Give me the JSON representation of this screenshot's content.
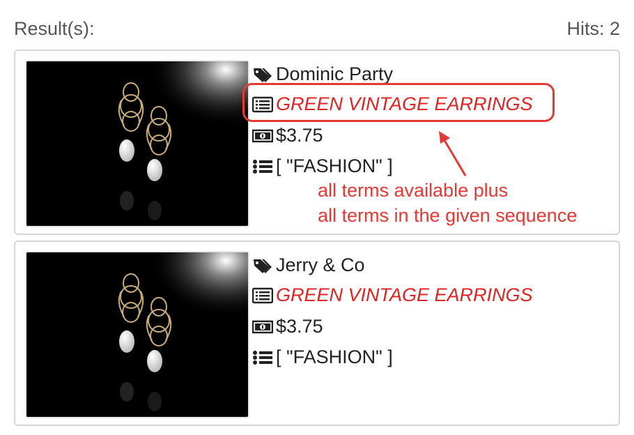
{
  "header": {
    "results_label": "Result(s):",
    "hits_label": "Hits: 2"
  },
  "results": [
    {
      "vendor": "Dominic Party",
      "title": "GREEN VINTAGE EARRINGS",
      "price": "$3.75",
      "categories": "[ \"FASHION\" ]"
    },
    {
      "vendor": "Jerry & Co",
      "title": "GREEN VINTAGE EARRINGS",
      "price": "$3.75",
      "categories": "[ \"FASHION\" ]"
    }
  ],
  "annotation": {
    "line1": "all terms available plus",
    "line2": "all terms in the given sequence",
    "color": "#e53935"
  },
  "icons": {
    "vendor": "tags-icon",
    "title": "list-alt-icon",
    "price": "money-bill-icon",
    "categories": "list-icon"
  }
}
